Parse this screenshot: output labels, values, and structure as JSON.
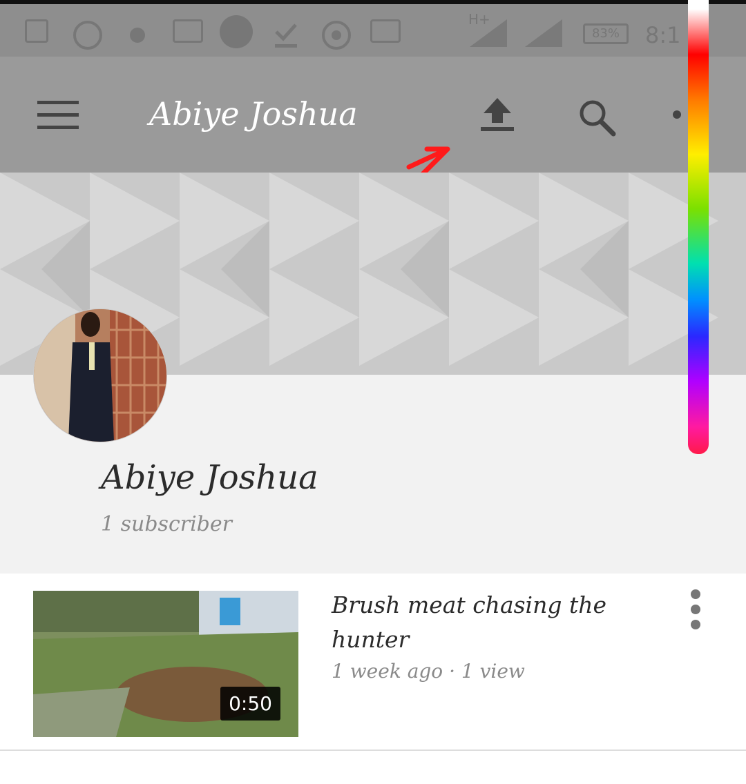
{
  "status_bar": {
    "network": "H+",
    "battery": "83%",
    "time": "8:1"
  },
  "header": {
    "title": "Abiye Joshua",
    "icons": [
      "menu-icon",
      "upload-icon",
      "search-icon",
      "more-vert-icon"
    ]
  },
  "channel": {
    "name": "Abiye Joshua",
    "subscribers": "1 subscriber"
  },
  "videos": [
    {
      "title": "Brush meat chasing the hunter",
      "meta": "1 week ago · 1 view",
      "duration": "0:50"
    }
  ],
  "colors": {
    "appbar": "#9a9a9a",
    "profile_bg": "#f2f2f2",
    "annotation": "#ff1a1a"
  }
}
